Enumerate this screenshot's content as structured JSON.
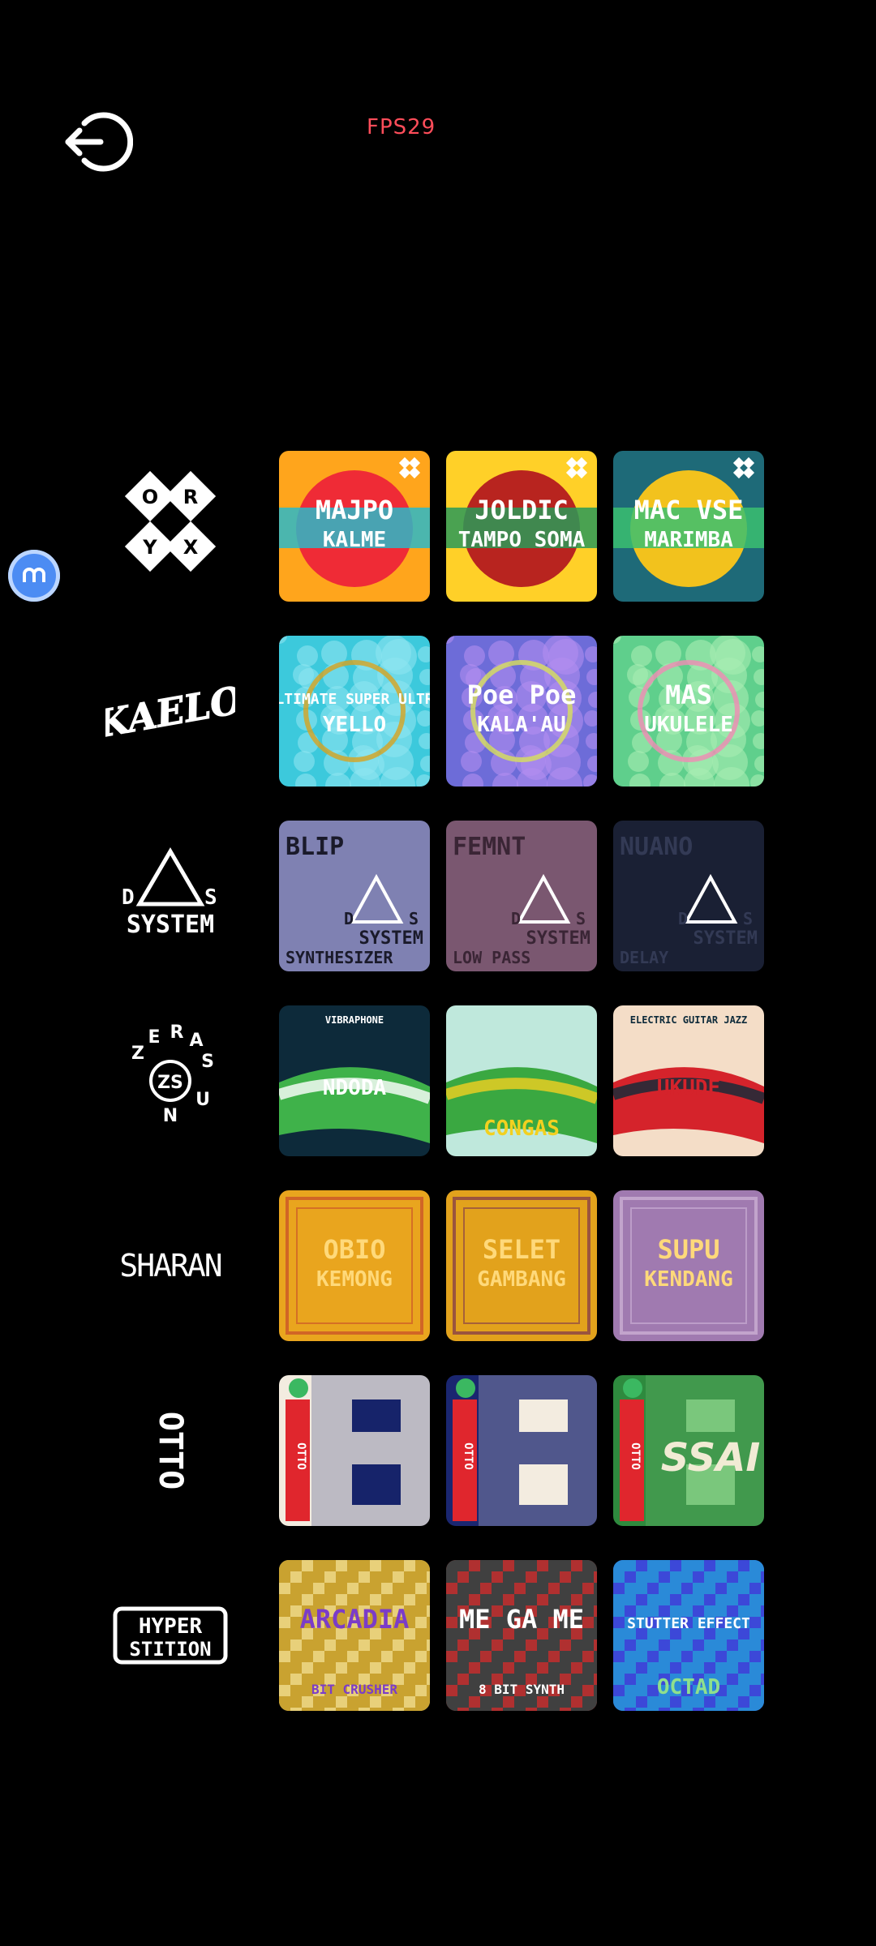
{
  "status": {
    "fps": "FPS29"
  },
  "brands": [
    {
      "name": "orxy",
      "logo_text": [
        "O",
        "R",
        "Y",
        "X"
      ],
      "instruments": [
        {
          "title_top": "MAJPO",
          "title_bottom": "KALME",
          "colors": [
            "#ffa51c",
            "#ef2b36",
            "#2bb8c8"
          ]
        },
        {
          "title_top": "JOLDIC",
          "title_bottom": "TAMPO SOMA",
          "colors": [
            "#ffd028",
            "#b8241f",
            "#2a9a58"
          ]
        },
        {
          "title_top": "MAC VSE",
          "title_bottom": "MARIMBA",
          "colors": [
            "#1e6a78",
            "#f2c21d",
            "#3bbf70"
          ]
        }
      ]
    },
    {
      "name": "kaelo",
      "logo_text": "KAELO",
      "instruments": [
        {
          "title_top": "ULTIMATE SUPER ULTRA",
          "title_bottom": "YELLO",
          "colors": [
            "#3cc9dc",
            "#8ee4f0",
            "#d7a21f"
          ]
        },
        {
          "title_top": "Poe Poe",
          "title_bottom": "KALA'AU",
          "colors": [
            "#6d6cd8",
            "#b28df0",
            "#d8e05b"
          ]
        },
        {
          "title_top": "MAS",
          "title_bottom": "UKULELE",
          "colors": [
            "#5fcf8c",
            "#a8edb3",
            "#f08bb4"
          ]
        }
      ]
    },
    {
      "name": "das-system",
      "logo_text": [
        "D",
        "S",
        "SYSTEM"
      ],
      "instruments": [
        {
          "title_top": "BLIP",
          "title_bottom": "SYNTHESIZER",
          "colors": [
            "#7f81b2",
            "#1a1a2a",
            "#ffffff"
          ]
        },
        {
          "title_top": "FEMNT",
          "title_bottom": "LOW PASS",
          "colors": [
            "#7a5770",
            "#3a2535",
            "#ffffff"
          ]
        },
        {
          "title_top": "NUANO",
          "title_bottom": "DELAY",
          "colors": [
            "#1a2034",
            "#333a55",
            "#ffffff"
          ]
        }
      ]
    },
    {
      "name": "zerasun",
      "logo_text": [
        "Z",
        "E",
        "R",
        "A",
        "S",
        "U",
        "N",
        "ZS"
      ],
      "instruments": [
        {
          "title_top": "VIBRAPHONE",
          "title_bottom": "NDODA",
          "colors": [
            "#0d2a3a",
            "#3fb24a",
            "#ffffff"
          ]
        },
        {
          "title_top": "",
          "title_bottom": "CONGAS",
          "colors": [
            "#bfe8dc",
            "#3aa841",
            "#f2d020"
          ]
        },
        {
          "title_top": "ELECTRIC GUITAR JAZZ",
          "title_bottom": "UKUDE",
          "colors": [
            "#f4ddc7",
            "#d5232b",
            "#0d2a3a"
          ]
        }
      ]
    },
    {
      "name": "sharan",
      "logo_text": "SHARAN",
      "instruments": [
        {
          "title_top": "OBIO",
          "title_bottom": "KEMONG",
          "colors": [
            "#e9a51e",
            "#5a1e3f",
            "#c23b2b"
          ]
        },
        {
          "title_top": "SELET",
          "title_bottom": "GAMBANG",
          "colors": [
            "#e2a21c",
            "#8a2d8a",
            "#6a2055"
          ]
        },
        {
          "title_top": "SUPU",
          "title_bottom": "KENDANG",
          "colors": [
            "#a07ab0",
            "#6a4a86",
            "#d8c0e0"
          ]
        }
      ]
    },
    {
      "name": "otto",
      "logo_text": "OTTO",
      "instruments": [
        {
          "title_top": "OTTO",
          "title_bottom": "",
          "colors": [
            "#f3ece0",
            "#16236a",
            "#e0262d"
          ]
        },
        {
          "title_top": "OTTO",
          "title_bottom": "",
          "colors": [
            "#1a2670",
            "#f3ece0",
            "#e0262d"
          ]
        },
        {
          "title_top": "OTTO",
          "title_bottom": "SSAI",
          "colors": [
            "#2e8a3e",
            "#7ac77c",
            "#e0262d"
          ]
        }
      ]
    },
    {
      "name": "hyperstition",
      "logo_text": [
        "HYPER",
        "STITION"
      ],
      "instruments": [
        {
          "title_top": "ARCADIA",
          "title_bottom": "BIT CRUSHER",
          "colors": [
            "#e8d07a",
            "#c9a230",
            "#7b3cc8"
          ]
        },
        {
          "title_top": "ME GA ME",
          "title_bottom": "8 BIT SYNTH",
          "colors": [
            "#b03030",
            "#404040",
            "#e8a0c8"
          ]
        },
        {
          "title_top": "STUTTER EFFECT",
          "title_bottom": "OCTAD",
          "colors": [
            "#3c48d8",
            "#2a8ad8",
            "#8fe08c"
          ]
        }
      ]
    }
  ]
}
